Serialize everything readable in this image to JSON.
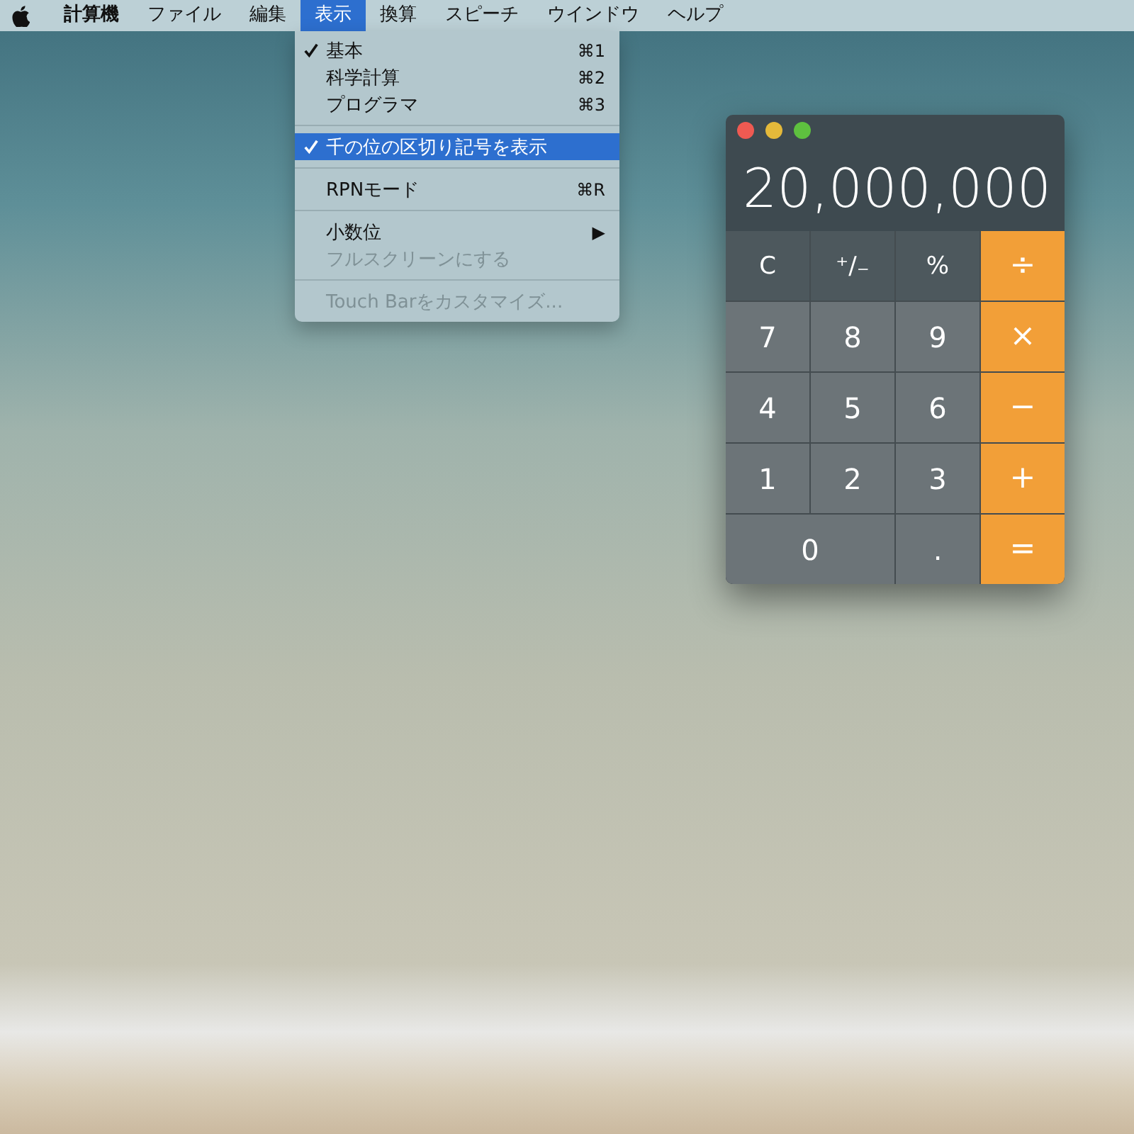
{
  "menu_bar": {
    "items": [
      {
        "label": "計算機",
        "kind": "app",
        "selected": false
      },
      {
        "label": "ファイル",
        "kind": "menu",
        "selected": false
      },
      {
        "label": "編集",
        "kind": "menu",
        "selected": false
      },
      {
        "label": "表示",
        "kind": "menu",
        "selected": true
      },
      {
        "label": "換算",
        "kind": "menu",
        "selected": false
      },
      {
        "label": "スピーチ",
        "kind": "menu",
        "selected": false
      },
      {
        "label": "ウインドウ",
        "kind": "menu",
        "selected": false
      },
      {
        "label": "ヘルプ",
        "kind": "menu",
        "selected": false
      }
    ]
  },
  "dropdown": {
    "groups": [
      {
        "items": [
          {
            "label": "基本",
            "checked": true,
            "selected": false,
            "disabled": false,
            "shortcut": "⌘1"
          },
          {
            "label": "科学計算",
            "checked": false,
            "selected": false,
            "disabled": false,
            "shortcut": "⌘2"
          },
          {
            "label": "プログラマ",
            "checked": false,
            "selected": false,
            "disabled": false,
            "shortcut": "⌘3"
          }
        ]
      },
      {
        "items": [
          {
            "label": "千の位の区切り記号を表示",
            "checked": true,
            "selected": true,
            "disabled": false
          }
        ]
      },
      {
        "items": [
          {
            "label": "RPNモード",
            "checked": false,
            "selected": false,
            "disabled": false,
            "shortcut": "⌘R"
          }
        ]
      },
      {
        "items": [
          {
            "label": "小数位",
            "checked": false,
            "selected": false,
            "disabled": false,
            "submenu": "▶"
          },
          {
            "label": "フルスクリーンにする",
            "checked": false,
            "selected": false,
            "disabled": true
          }
        ]
      },
      {
        "items": [
          {
            "label": "Touch Barをカスタマイズ...",
            "checked": false,
            "selected": false,
            "disabled": true
          }
        ]
      }
    ]
  },
  "calculator": {
    "display": "20,000,000",
    "keys": [
      {
        "label": "C",
        "kind": "function"
      },
      {
        "label": "⁺∕₋",
        "kind": "function"
      },
      {
        "label": "%",
        "kind": "function"
      },
      {
        "label": "÷",
        "kind": "operator"
      },
      {
        "label": "7",
        "kind": "digit"
      },
      {
        "label": "8",
        "kind": "digit"
      },
      {
        "label": "9",
        "kind": "digit"
      },
      {
        "label": "×",
        "kind": "operator"
      },
      {
        "label": "4",
        "kind": "digit"
      },
      {
        "label": "5",
        "kind": "digit"
      },
      {
        "label": "6",
        "kind": "digit"
      },
      {
        "label": "−",
        "kind": "operator"
      },
      {
        "label": "1",
        "kind": "digit"
      },
      {
        "label": "2",
        "kind": "digit"
      },
      {
        "label": "3",
        "kind": "digit"
      },
      {
        "label": "+",
        "kind": "operator"
      },
      {
        "label": "0",
        "kind": "wide"
      },
      {
        "label": ".",
        "kind": "digit"
      },
      {
        "label": "=",
        "kind": "operator"
      }
    ]
  }
}
